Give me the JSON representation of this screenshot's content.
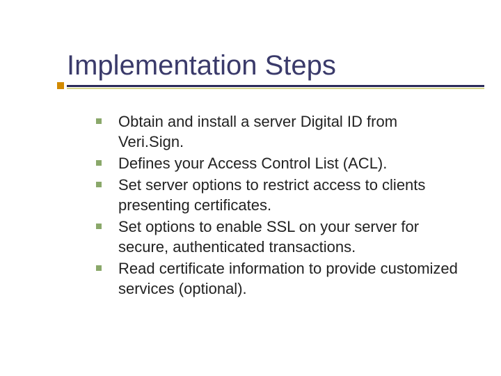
{
  "title": "Implementation Steps",
  "bullets": {
    "items": [
      {
        "text": "Obtain and install a server Digital ID from Veri.Sign."
      },
      {
        "text": "Defines your Access Control List (ACL)."
      },
      {
        "text": "Set server options to restrict access to clients presenting certificates."
      },
      {
        "text": "Set options to enable SSL on your server for secure, authenticated transactions."
      },
      {
        "text": "Read certificate information to provide customized services (optional)."
      }
    ]
  }
}
